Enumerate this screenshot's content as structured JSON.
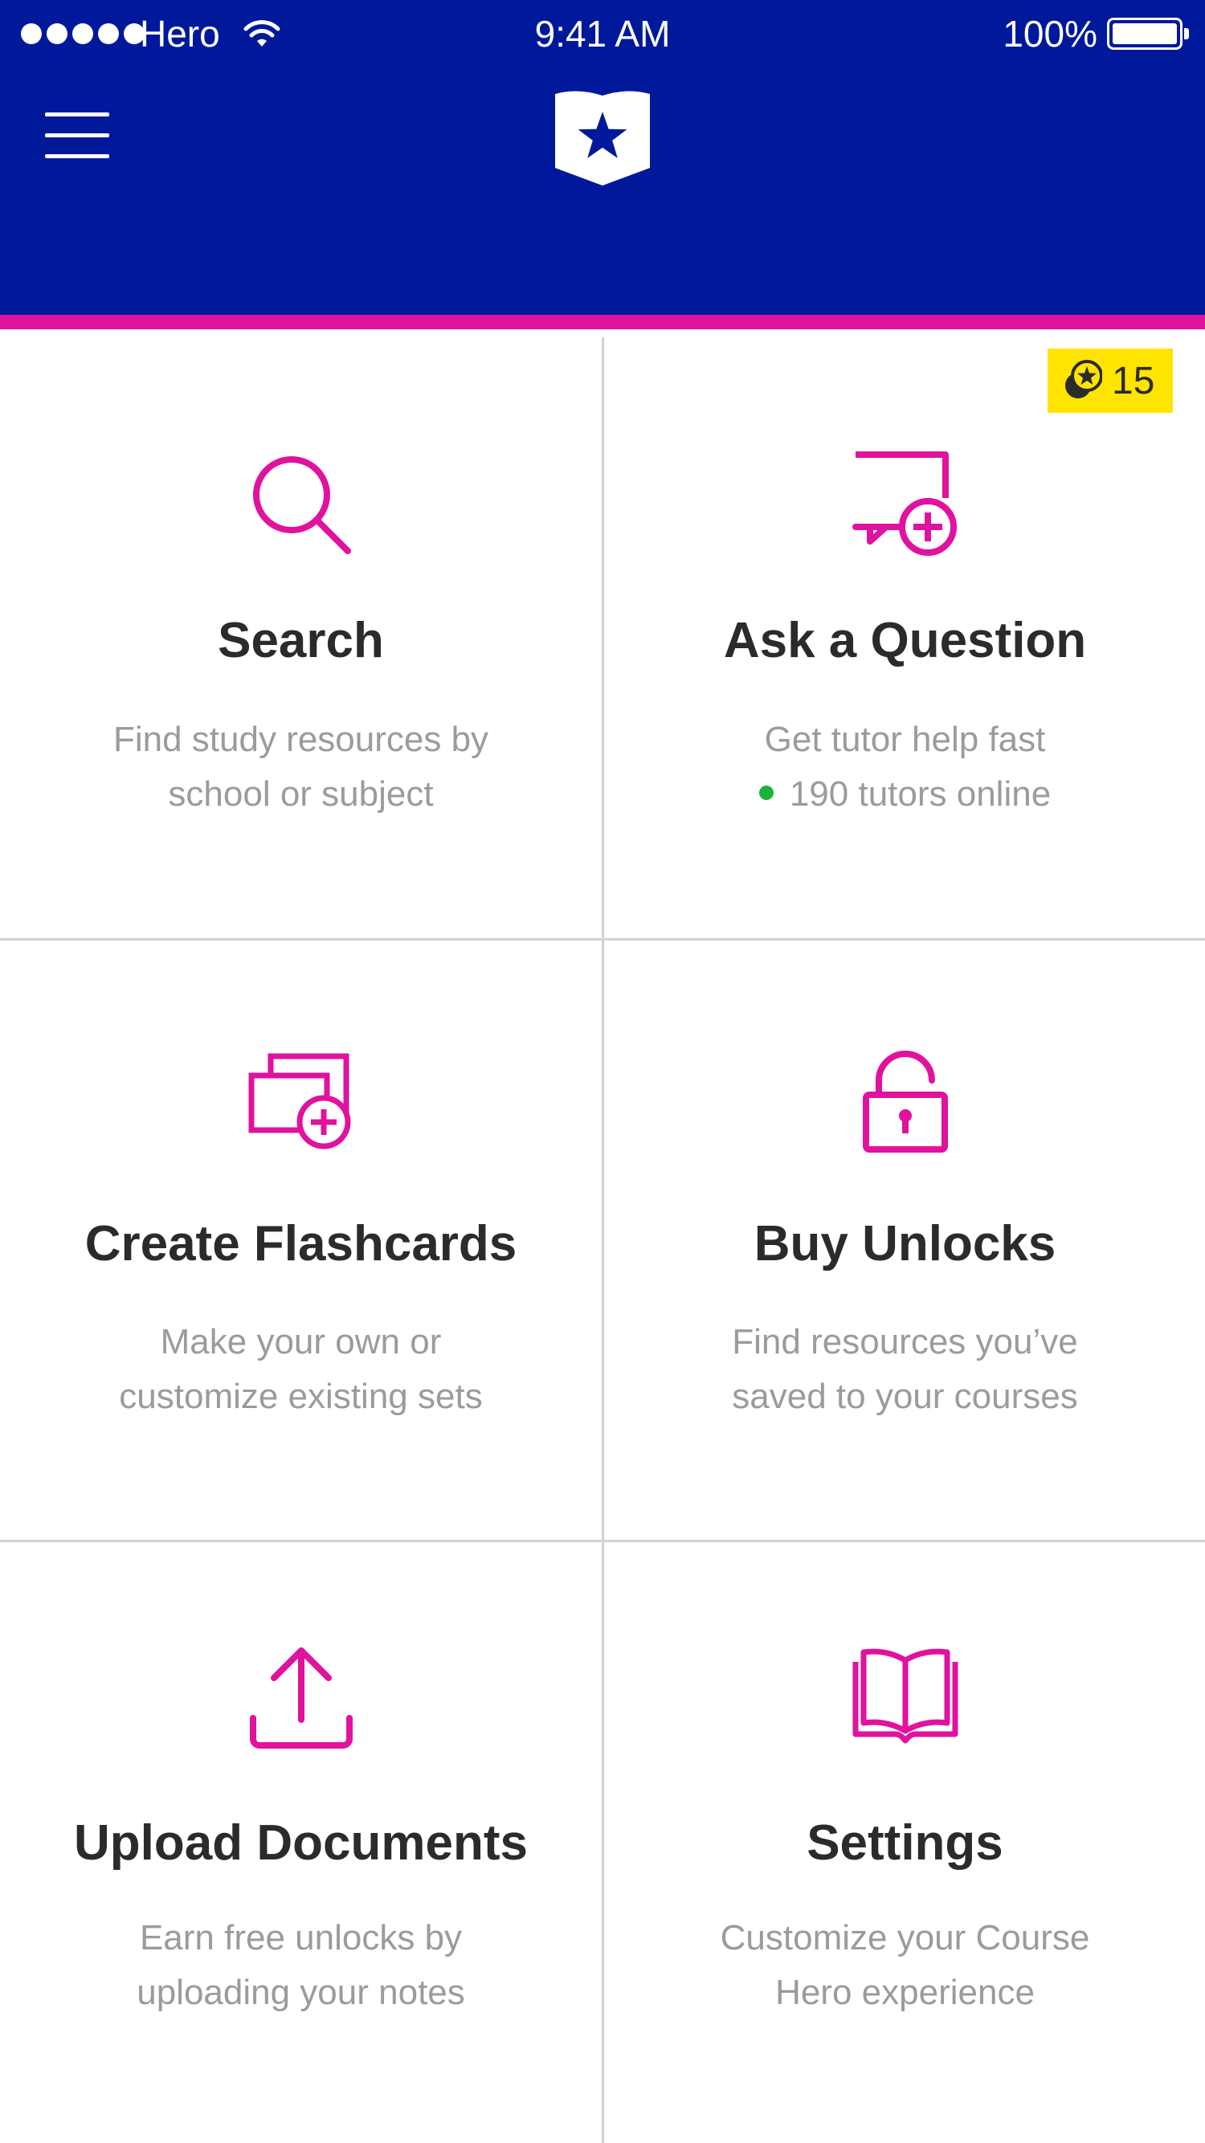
{
  "status_bar": {
    "carrier": "Hero",
    "time": "9:41 AM",
    "battery": "100%"
  },
  "header": {
    "menu_icon": "hamburger-menu-icon",
    "logo_icon": "course-hero-star-shield-logo"
  },
  "badge": {
    "icon": "coins-star-icon",
    "count": "15"
  },
  "tiles": [
    {
      "icon": "search-icon",
      "title": "Search",
      "desc_line1": "Find study resources by",
      "desc_line2": "school or subject"
    },
    {
      "icon": "chat-add-icon",
      "title": "Ask a Question",
      "desc_line1": "Get tutor help fast",
      "desc_line2": "190 tutors online"
    },
    {
      "icon": "flashcards-add-icon",
      "title": "Create Flashcards",
      "desc_line1": "Make your own or",
      "desc_line2": "customize existing sets"
    },
    {
      "icon": "unlock-icon",
      "title": "Buy Unlocks",
      "desc_line1": "Find resources you’ve",
      "desc_line2": "saved to your courses"
    },
    {
      "icon": "upload-icon",
      "title": "Upload Documents",
      "desc_line1": "Earn free unlocks by",
      "desc_line2": "uploading your notes"
    },
    {
      "icon": "book-icon",
      "title": "Settings",
      "desc_line1": "Customize your Course",
      "desc_line2": "Hero experience"
    }
  ],
  "colors": {
    "header_bg": "#00199b",
    "accent": "#e0129e",
    "badge_bg": "#ffe400",
    "online": "#1db33a",
    "title_text": "#2b2b2b",
    "desc_text": "#9b9b9b"
  }
}
